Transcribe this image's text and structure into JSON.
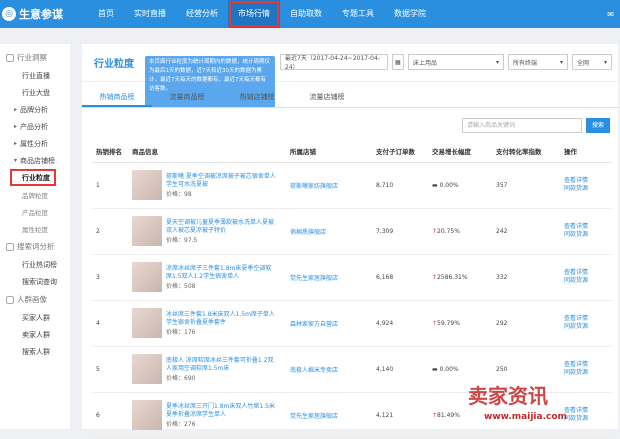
{
  "app": {
    "logo_text": "生意参谋",
    "logo_glyph": "◎"
  },
  "nav": {
    "items": [
      "首页",
      "实时直播",
      "经营分析",
      "市场行情",
      "自助取数",
      "专题工具",
      "数据学院"
    ],
    "active": "市场行情"
  },
  "sidebar": {
    "group1": "行业洞察",
    "g1_items": [
      "行业直播",
      "行业大盘"
    ],
    "expanders": [
      "品牌分析",
      "产品分析",
      "属性分析",
      "商品店铺榜"
    ],
    "active": "行业粒度",
    "sub_items": [
      "品牌粒度",
      "产品粒度",
      "属性粒度"
    ],
    "group2": "搜索词分析",
    "g2_items": [
      "行业热词榜",
      "搜索词查询"
    ],
    "group3": "人群画像",
    "g3_items": [
      "买家人群",
      "卖家人群",
      "搜索人群"
    ]
  },
  "main": {
    "title": "行业粒度",
    "tooltip": "本页面行业粒度为统计周期内的数据，统计周期仅为最后1天的数据，近7天和近30天的数据为累计，最近7天每天的数据都有，最近7天每天都有访客数。",
    "date_range": "最近7天（2017-04-24~2017-04-24）",
    "category": "床上用品",
    "terminal": "所有终端",
    "extra": "全网"
  },
  "tabs": [
    "热销商品榜",
    "流量商品榜",
    "热销店铺榜",
    "流量店铺榜"
  ],
  "search": {
    "placeholder": "请输入商品关键词",
    "button": "搜索"
  },
  "table": {
    "headers": [
      "热销排名",
      "商品信息",
      "所属店铺",
      "支付子订单数",
      "交易增长幅度",
      "支付转化率指数",
      "操作"
    ],
    "rows": [
      {
        "rank": "1",
        "title": "荷斯曦 夏季空调被凉席被子被芯宿舍单人学生可水洗夏被",
        "price": "价格：98",
        "shop": "荷斯曦家纺旗舰店",
        "orders": "8,710",
        "growth": "0.00%",
        "trend": "",
        "conv": "357",
        "a1": "查看详情",
        "a2": "同款货源"
      },
      {
        "rank": "2",
        "title": "夏天空调被儿童夏季薄款被水洗单人夏被双人被芯夏凉被子特价",
        "price": "价格：97.5",
        "shop": "俏棉质旗舰店",
        "orders": "7,309",
        "growth": "20.75%",
        "trend": "up",
        "conv": "242",
        "a1": "查看详情",
        "a2": "同款货源"
      },
      {
        "rank": "3",
        "title": "凉席冰丝席子三件套1.8m床夏季空调软席1.5双人1.2学生宿舍单人",
        "price": "价格：508",
        "shop": "觉先生家居旗舰店",
        "orders": "6,168",
        "growth": "2586.31%",
        "trend": "up",
        "conv": "332",
        "a1": "查看详情",
        "a2": "同款货源"
      },
      {
        "rank": "4",
        "title": "冰丝席三件套1.8米床双人1.5m席子单人学生宿舍折叠夏季套件",
        "price": "价格：176",
        "shop": "森林家家方自营店",
        "orders": "4,924",
        "growth": "59.79%",
        "trend": "up",
        "conv": "292",
        "a1": "查看详情",
        "a2": "同款货源"
      },
      {
        "rank": "5",
        "title": "南极人 凉席软席冰丝三件套可折叠1.2双人家用空调软席1.5m床",
        "price": "价格：690",
        "shop": "南极人棉米专卖店",
        "orders": "4,140",
        "growth": "0.00%",
        "trend": "",
        "conv": "250",
        "a1": "查看详情",
        "a2": "同款货源"
      },
      {
        "rank": "6",
        "title": "夏季冰丝席三开门1.8m床双人竹席1.5米夏季折叠凉席学生单人",
        "price": "价格：276",
        "shop": "觉先生家居旗舰店",
        "orders": "4,121",
        "growth": "81.49%",
        "trend": "up",
        "conv": "",
        "a1": "查看详情",
        "a2": "同款货源"
      }
    ]
  },
  "watermark": {
    "text": "卖家资讯",
    "url": "www.maijia.com"
  },
  "colors": {
    "brand": "#2b8fe0",
    "highlight": "#e53935"
  }
}
